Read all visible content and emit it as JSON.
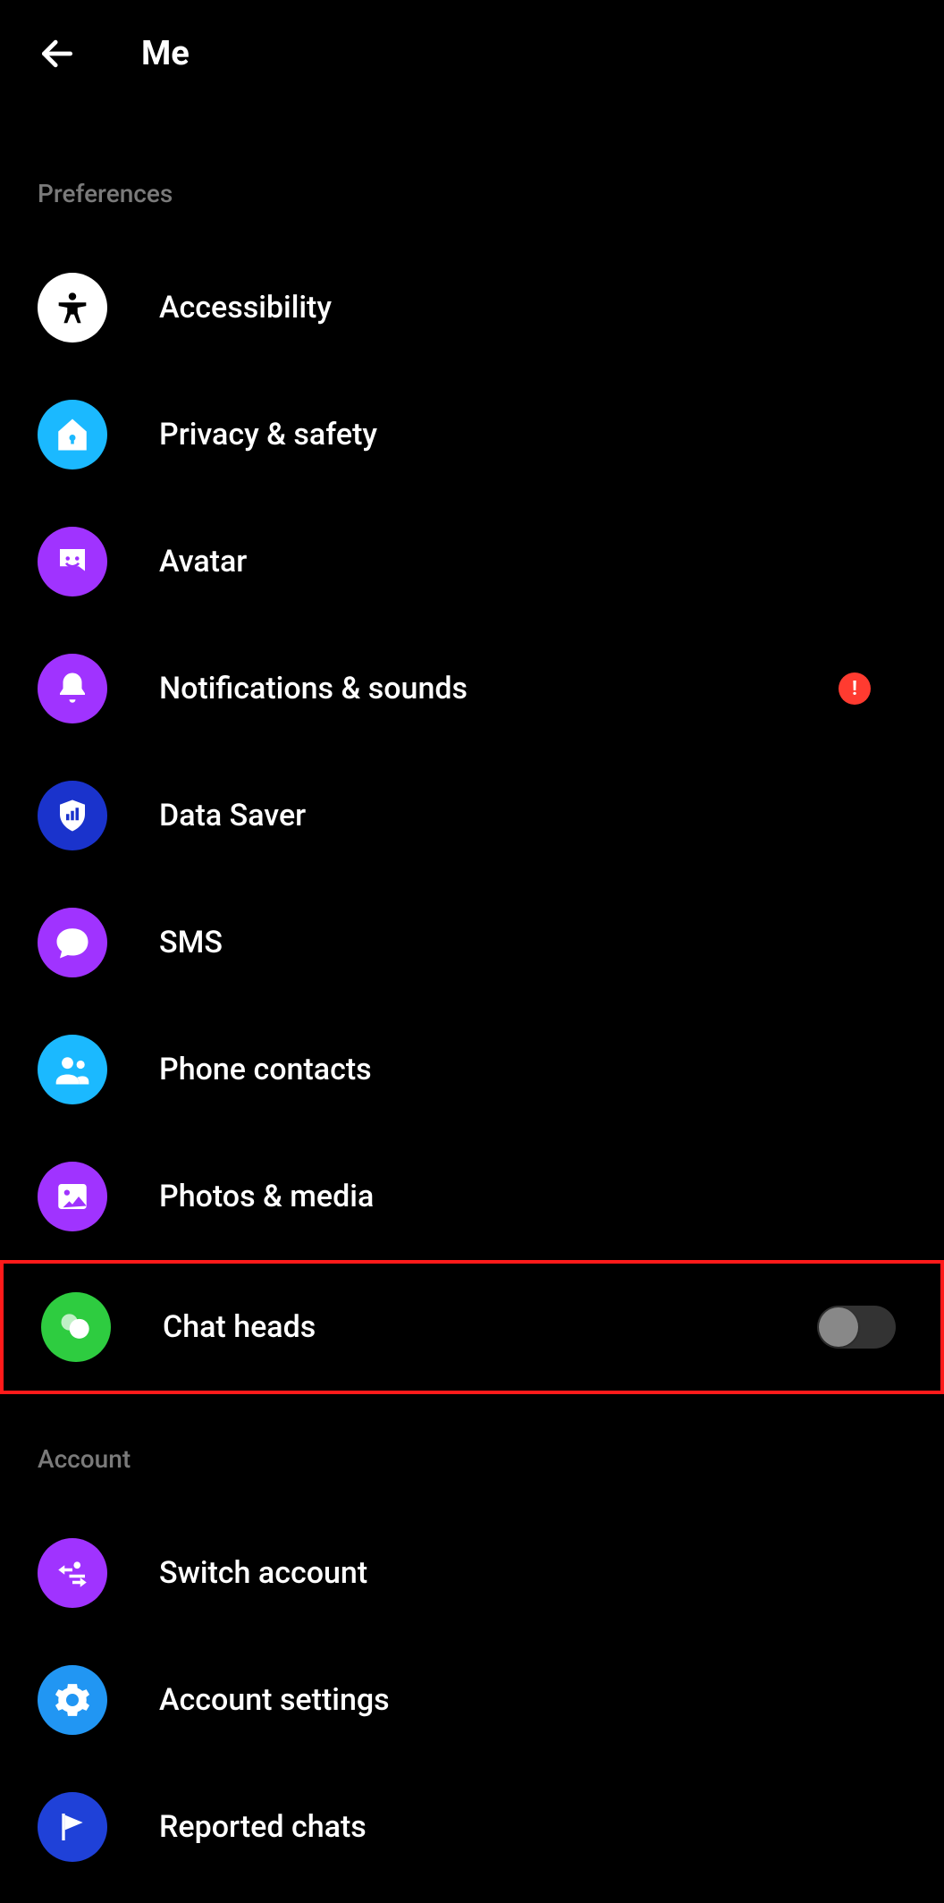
{
  "header": {
    "title": "Me"
  },
  "sections": {
    "preferences": {
      "title": "Preferences",
      "items": {
        "accessibility": {
          "label": "Accessibility"
        },
        "privacy_safety": {
          "label": "Privacy & safety"
        },
        "avatar": {
          "label": "Avatar"
        },
        "notifications_sounds": {
          "label": "Notifications & sounds",
          "alert": "!"
        },
        "data_saver": {
          "label": "Data Saver"
        },
        "sms": {
          "label": "SMS"
        },
        "phone_contacts": {
          "label": "Phone contacts"
        },
        "photos_media": {
          "label": "Photos & media"
        },
        "chat_heads": {
          "label": "Chat heads",
          "toggle": false,
          "highlighted": true
        }
      }
    },
    "account": {
      "title": "Account",
      "items": {
        "switch_account": {
          "label": "Switch account"
        },
        "account_settings": {
          "label": "Account settings"
        },
        "reported_chats": {
          "label": "Reported chats"
        }
      }
    }
  },
  "colors": {
    "white": "#ffffff",
    "cyan": "#1bb9ff",
    "purple": "#a033ff",
    "dblue": "#1a33cc",
    "skyblue": "#2196f3",
    "mblue": "#1f41d8",
    "green": "#2ecc40",
    "alert": "#ff3b30",
    "highlight": "#ff1a1a"
  }
}
